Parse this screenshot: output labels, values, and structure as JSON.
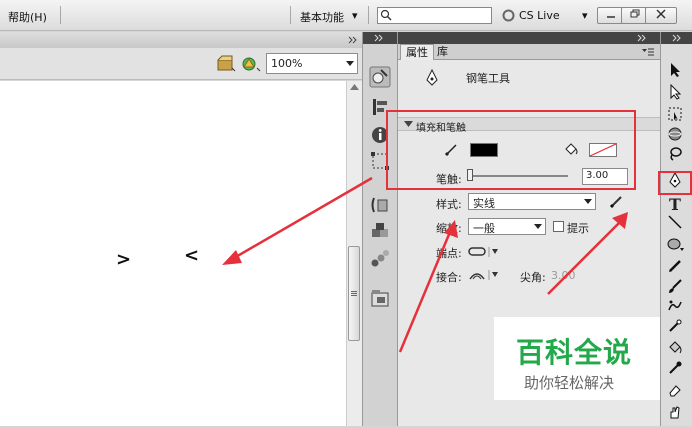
{
  "menubar": {
    "help_menu": "帮助(H)",
    "workspace": "基本功能",
    "workspace_arrow": "▾",
    "cs_live": "CS Live",
    "cs_live_arrow": "▾"
  },
  "stage": {
    "zoom_value": "100%",
    "canvas_glyph_right": ">",
    "canvas_glyph_left": "<"
  },
  "panel": {
    "tabs": [
      {
        "label": "属性"
      },
      {
        "label": "库"
      }
    ],
    "tool_name": "钢笔工具",
    "fill_stroke_section": "填充和笔触",
    "stroke_label": "笔触:",
    "stroke_value": "3.00",
    "style_label": "样式:",
    "style_value": "实线",
    "scale_label": "缩放:",
    "scale_value": "一般",
    "hint_label": "提示",
    "cap_label": "端点:",
    "join_label": "接合:",
    "miter_label": "尖角:",
    "miter_value": "3.00"
  },
  "watermark": {
    "title": "百科全说",
    "subtitle": "助你轻松解决"
  },
  "colors": {
    "accent_red": "#e4313b",
    "watermark_green": "#23a84a"
  }
}
